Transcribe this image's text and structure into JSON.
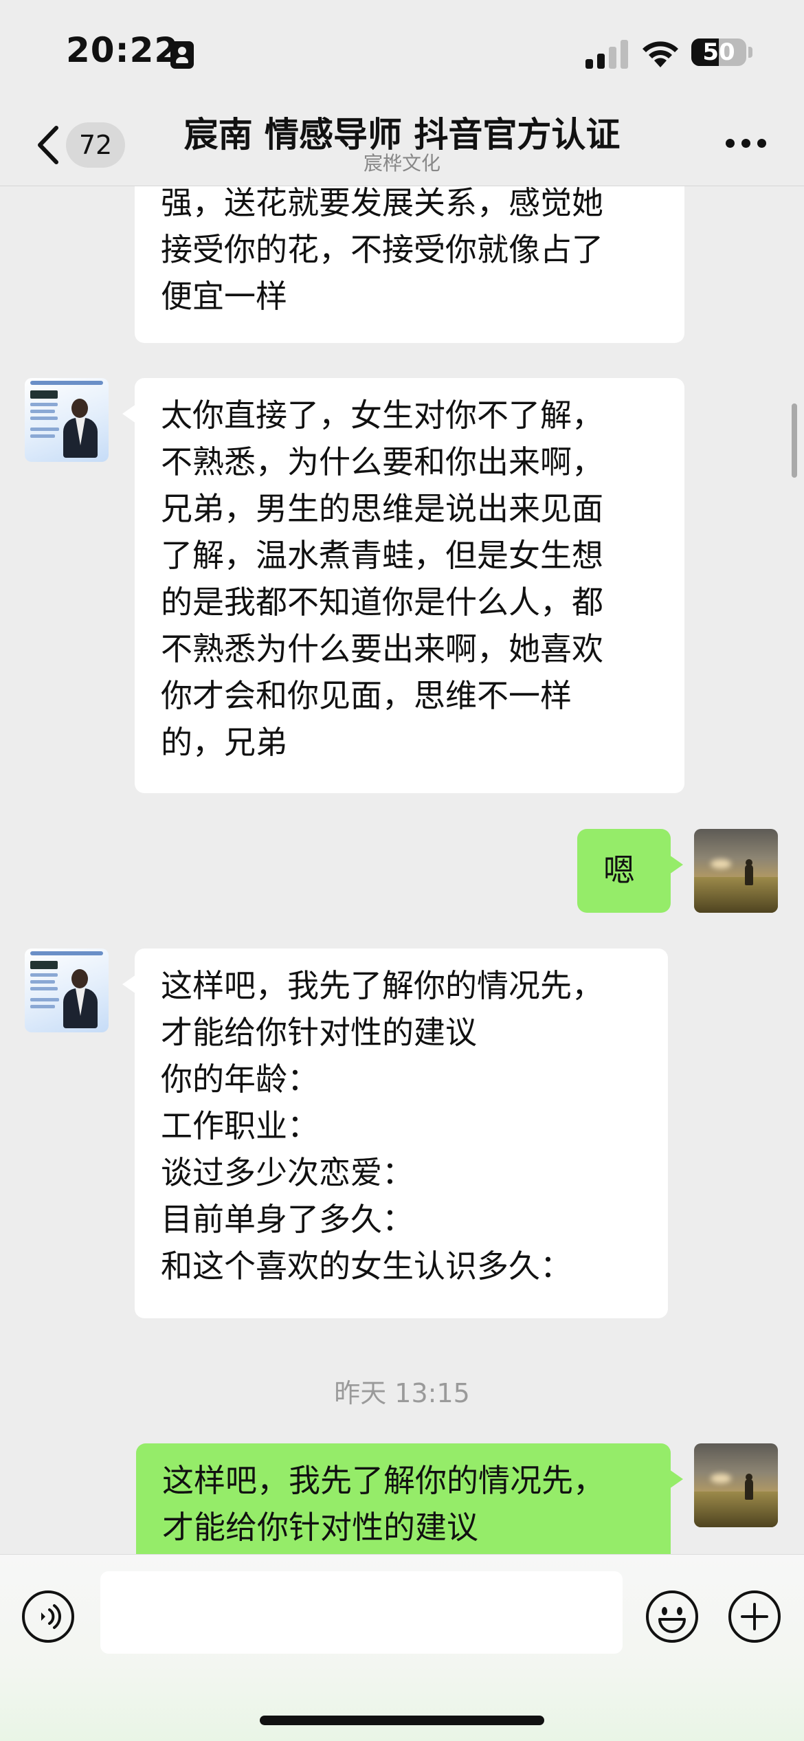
{
  "status_bar": {
    "time": "20:22",
    "battery_level": "50",
    "battery_fraction": 0.5
  },
  "nav": {
    "unread_count": "72",
    "title": "宸南 情感导师 抖音官方认证",
    "subtitle": "宸桦文化"
  },
  "messages": [
    {
      "sender": "mentor",
      "text": "强，送花就要发展关系，感觉她\n接受你的花，不接受你就像占了\n便宜一样"
    },
    {
      "sender": "mentor",
      "text": "太你直接了，女生对你不了解，\n不熟悉，为什么要和你出来啊，\n兄弟，男生的思维是说出来见面\n了解，温水煮青蛙，但是女生想\n的是我都不知道你是什么人，都\n不熟悉为什么要出来啊，她喜欢\n你才会和你见面，思维不一样\n的，兄弟"
    },
    {
      "sender": "user",
      "text": "嗯"
    },
    {
      "sender": "mentor",
      "text": "这样吧，我先了解你的情况先，\n才能给你针对性的建议\n你的年龄：\n工作职业：\n谈过多少次恋爱：\n目前单身了多久：\n和这个喜欢的女生认识多久："
    },
    {
      "sender": "user",
      "text": "这样吧，我先了解你的情况先，\n才能给你针对性的建议"
    }
  ],
  "timestamp": "昨天 13:15",
  "input": {
    "value": "",
    "placeholder": ""
  },
  "icons": {
    "back": "chevron-left-icon",
    "more": "more-horizontal-icon",
    "voice": "voice-icon",
    "emoji": "emoji-icon",
    "plus": "plus-icon"
  },
  "colors": {
    "background": "#ededed",
    "incoming_bubble": "#ffffff",
    "outgoing_bubble": "#95ec69",
    "timestamp": "#9a9a9a"
  }
}
